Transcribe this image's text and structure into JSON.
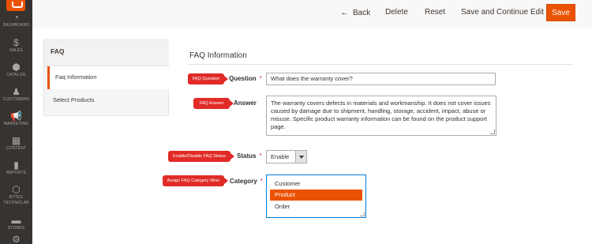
{
  "sidebar": {
    "items": [
      {
        "label": "DASHBOARD",
        "icon": "dashboard-icon",
        "glyph": "◔"
      },
      {
        "label": "SALES",
        "icon": "dollar-icon",
        "glyph": "$"
      },
      {
        "label": "CATALOG",
        "icon": "catalog-icon",
        "glyph": "⬢"
      },
      {
        "label": "CUSTOMERS",
        "icon": "customer-icon",
        "glyph": "♟"
      },
      {
        "label": "MARKETING",
        "icon": "megaphone-icon",
        "glyph": "📢"
      },
      {
        "label": "CONTENT",
        "icon": "content-icon",
        "glyph": "▦"
      },
      {
        "label": "REPORTS",
        "icon": "bar-chart-icon",
        "glyph": "▮"
      },
      {
        "label": "BYTES",
        "label2": "TECHNOLAB",
        "icon": "hexagon-icon",
        "glyph": "⬡"
      },
      {
        "label": "STORES",
        "icon": "store-icon",
        "glyph": "▬"
      },
      {
        "label": "",
        "icon": "gear-icon",
        "glyph": "⚙"
      }
    ]
  },
  "toolbar": {
    "back_label": "Back",
    "delete_label": "Delete",
    "reset_label": "Reset",
    "save_continue_label": "Save and Continue Edit",
    "save_label": "Save"
  },
  "tabs": {
    "title": "FAQ",
    "items": [
      "Faq Information",
      "Select Products"
    ]
  },
  "section": {
    "title": "FAQ Information"
  },
  "form": {
    "question_label": "Question",
    "question_value": "What does the warranty cover?",
    "answer_label": "Answer",
    "answer_value": "The warranty covers defects in materials and workmanship.  It does not cover issues caused by damage due to shipment, handling, storage, accident, impact, abuse or misuse. Specific product warranty information can be found on the product support page.",
    "status_label": "Status",
    "status_value": "Enable",
    "category_label": "Category",
    "category_options": [
      "Customer",
      "Product",
      "Order"
    ],
    "category_selected": "Product",
    "required_mark": "*"
  },
  "callouts": {
    "question": "FAQ Question",
    "answer": "FAQ Answer",
    "status": "Enable/Disable FAQ Status",
    "category": "Assign FAQ Category Wise"
  },
  "colors": {
    "accent": "#eb5202",
    "sidebar": "#373330",
    "callout": "#e02b27"
  }
}
